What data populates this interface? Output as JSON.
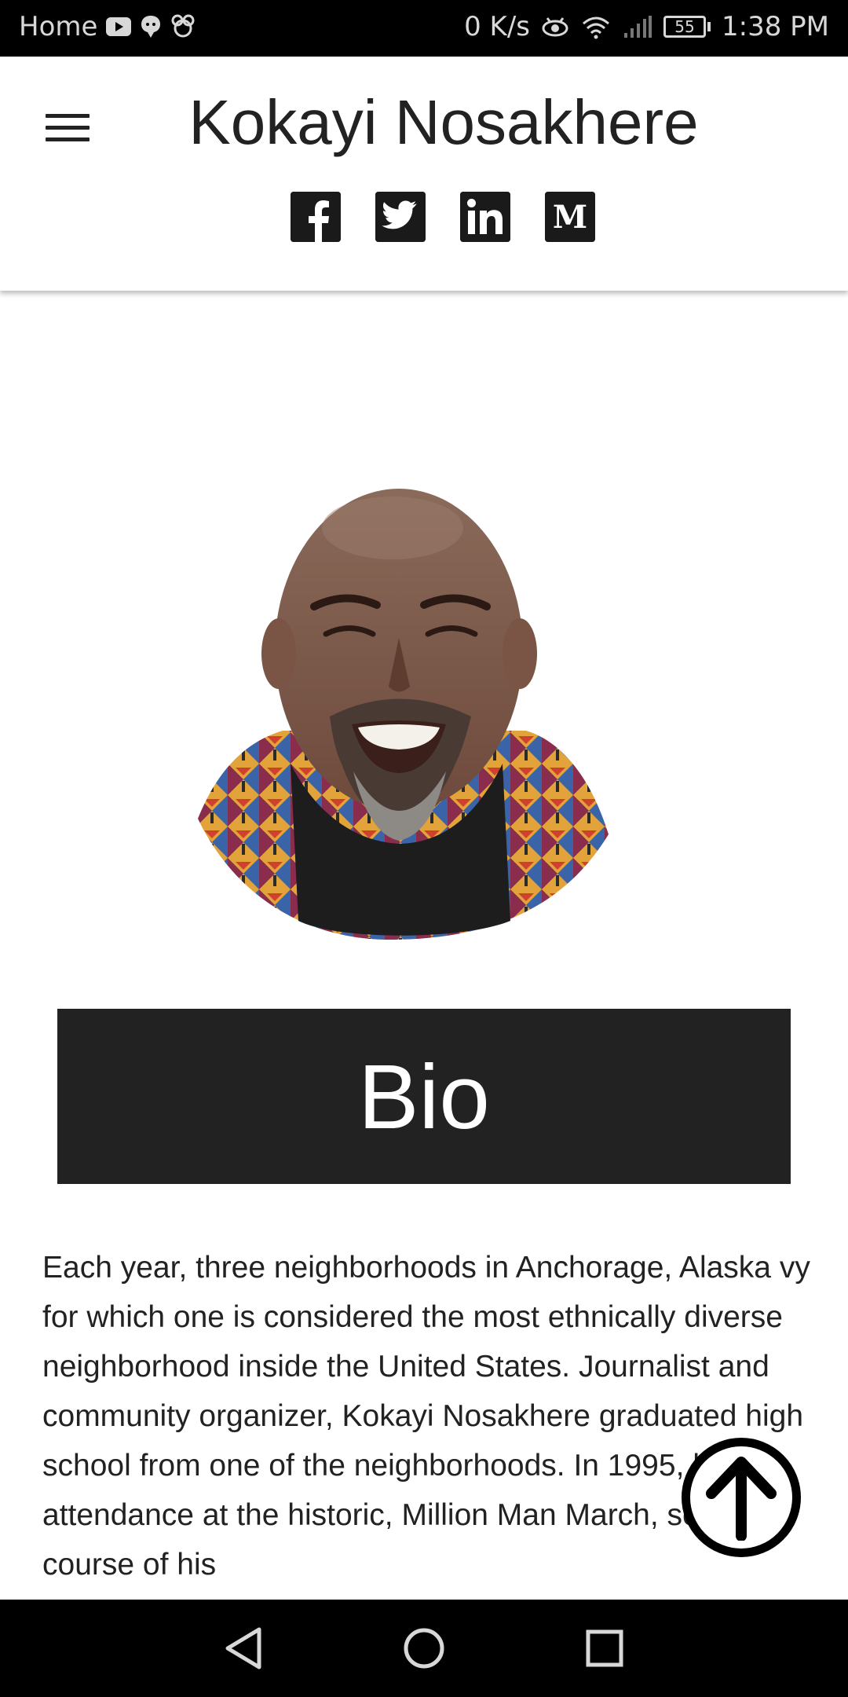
{
  "status_bar": {
    "carrier_label": "Home",
    "net_speed": "0 K/s",
    "battery": "55",
    "time": "1:38 PM",
    "icons": [
      "youtube-icon",
      "chat-icon",
      "bee-icon",
      "eye-icon",
      "wifi-icon",
      "signal-icon",
      "battery-icon"
    ]
  },
  "header": {
    "title": "Kokayi Nosakhere",
    "menu_icon": "hamburger-menu-icon",
    "social": [
      {
        "name": "facebook",
        "glyph": "f"
      },
      {
        "name": "twitter",
        "glyph": "t"
      },
      {
        "name": "linkedin",
        "glyph": "in"
      },
      {
        "name": "medium",
        "glyph": "M"
      }
    ]
  },
  "bio": {
    "heading": "Bio",
    "text": "Each year, three neighborhoods in Anchorage, Alaska vy for which one is considered the most ethnically diverse neighborhood inside the United States. Journalist and community organizer, Kokayi Nosakhere graduated high school from one of the neighborhoods. In 1995, his attendance at the historic, Million Man March, set the course of his"
  },
  "scroll_top": {
    "icon": "arrow-up-circle-icon"
  },
  "nav_bar": {
    "buttons": [
      "back-icon",
      "home-icon",
      "recents-icon"
    ]
  }
}
